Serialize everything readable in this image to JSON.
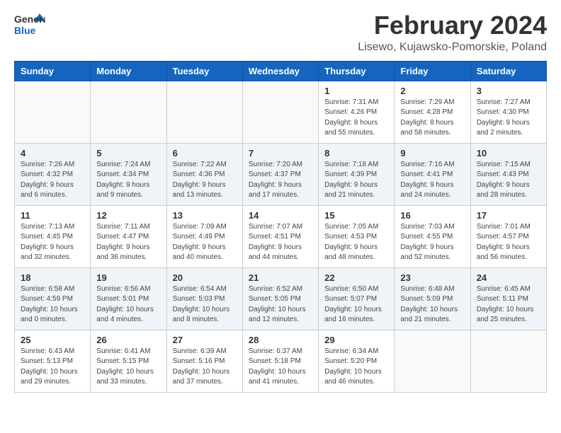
{
  "header": {
    "logo_general": "General",
    "logo_blue": "Blue",
    "month_title": "February 2024",
    "location": "Lisewo, Kujawsko-Pomorskie, Poland"
  },
  "weekdays": [
    "Sunday",
    "Monday",
    "Tuesday",
    "Wednesday",
    "Thursday",
    "Friday",
    "Saturday"
  ],
  "weeks": [
    [
      {
        "day": "",
        "info": ""
      },
      {
        "day": "",
        "info": ""
      },
      {
        "day": "",
        "info": ""
      },
      {
        "day": "",
        "info": ""
      },
      {
        "day": "1",
        "info": "Sunrise: 7:31 AM\nSunset: 4:26 PM\nDaylight: 8 hours\nand 55 minutes."
      },
      {
        "day": "2",
        "info": "Sunrise: 7:29 AM\nSunset: 4:28 PM\nDaylight: 8 hours\nand 58 minutes."
      },
      {
        "day": "3",
        "info": "Sunrise: 7:27 AM\nSunset: 4:30 PM\nDaylight: 9 hours\nand 2 minutes."
      }
    ],
    [
      {
        "day": "4",
        "info": "Sunrise: 7:26 AM\nSunset: 4:32 PM\nDaylight: 9 hours\nand 6 minutes."
      },
      {
        "day": "5",
        "info": "Sunrise: 7:24 AM\nSunset: 4:34 PM\nDaylight: 9 hours\nand 9 minutes."
      },
      {
        "day": "6",
        "info": "Sunrise: 7:22 AM\nSunset: 4:36 PM\nDaylight: 9 hours\nand 13 minutes."
      },
      {
        "day": "7",
        "info": "Sunrise: 7:20 AM\nSunset: 4:37 PM\nDaylight: 9 hours\nand 17 minutes."
      },
      {
        "day": "8",
        "info": "Sunrise: 7:18 AM\nSunset: 4:39 PM\nDaylight: 9 hours\nand 21 minutes."
      },
      {
        "day": "9",
        "info": "Sunrise: 7:16 AM\nSunset: 4:41 PM\nDaylight: 9 hours\nand 24 minutes."
      },
      {
        "day": "10",
        "info": "Sunrise: 7:15 AM\nSunset: 4:43 PM\nDaylight: 9 hours\nand 28 minutes."
      }
    ],
    [
      {
        "day": "11",
        "info": "Sunrise: 7:13 AM\nSunset: 4:45 PM\nDaylight: 9 hours\nand 32 minutes."
      },
      {
        "day": "12",
        "info": "Sunrise: 7:11 AM\nSunset: 4:47 PM\nDaylight: 9 hours\nand 36 minutes."
      },
      {
        "day": "13",
        "info": "Sunrise: 7:09 AM\nSunset: 4:49 PM\nDaylight: 9 hours\nand 40 minutes."
      },
      {
        "day": "14",
        "info": "Sunrise: 7:07 AM\nSunset: 4:51 PM\nDaylight: 9 hours\nand 44 minutes."
      },
      {
        "day": "15",
        "info": "Sunrise: 7:05 AM\nSunset: 4:53 PM\nDaylight: 9 hours\nand 48 minutes."
      },
      {
        "day": "16",
        "info": "Sunrise: 7:03 AM\nSunset: 4:55 PM\nDaylight: 9 hours\nand 52 minutes."
      },
      {
        "day": "17",
        "info": "Sunrise: 7:01 AM\nSunset: 4:57 PM\nDaylight: 9 hours\nand 56 minutes."
      }
    ],
    [
      {
        "day": "18",
        "info": "Sunrise: 6:58 AM\nSunset: 4:59 PM\nDaylight: 10 hours\nand 0 minutes."
      },
      {
        "day": "19",
        "info": "Sunrise: 6:56 AM\nSunset: 5:01 PM\nDaylight: 10 hours\nand 4 minutes."
      },
      {
        "day": "20",
        "info": "Sunrise: 6:54 AM\nSunset: 5:03 PM\nDaylight: 10 hours\nand 8 minutes."
      },
      {
        "day": "21",
        "info": "Sunrise: 6:52 AM\nSunset: 5:05 PM\nDaylight: 10 hours\nand 12 minutes."
      },
      {
        "day": "22",
        "info": "Sunrise: 6:50 AM\nSunset: 5:07 PM\nDaylight: 10 hours\nand 16 minutes."
      },
      {
        "day": "23",
        "info": "Sunrise: 6:48 AM\nSunset: 5:09 PM\nDaylight: 10 hours\nand 21 minutes."
      },
      {
        "day": "24",
        "info": "Sunrise: 6:45 AM\nSunset: 5:11 PM\nDaylight: 10 hours\nand 25 minutes."
      }
    ],
    [
      {
        "day": "25",
        "info": "Sunrise: 6:43 AM\nSunset: 5:13 PM\nDaylight: 10 hours\nand 29 minutes."
      },
      {
        "day": "26",
        "info": "Sunrise: 6:41 AM\nSunset: 5:15 PM\nDaylight: 10 hours\nand 33 minutes."
      },
      {
        "day": "27",
        "info": "Sunrise: 6:39 AM\nSunset: 5:16 PM\nDaylight: 10 hours\nand 37 minutes."
      },
      {
        "day": "28",
        "info": "Sunrise: 6:37 AM\nSunset: 5:18 PM\nDaylight: 10 hours\nand 41 minutes."
      },
      {
        "day": "29",
        "info": "Sunrise: 6:34 AM\nSunset: 5:20 PM\nDaylight: 10 hours\nand 46 minutes."
      },
      {
        "day": "",
        "info": ""
      },
      {
        "day": "",
        "info": ""
      }
    ]
  ]
}
